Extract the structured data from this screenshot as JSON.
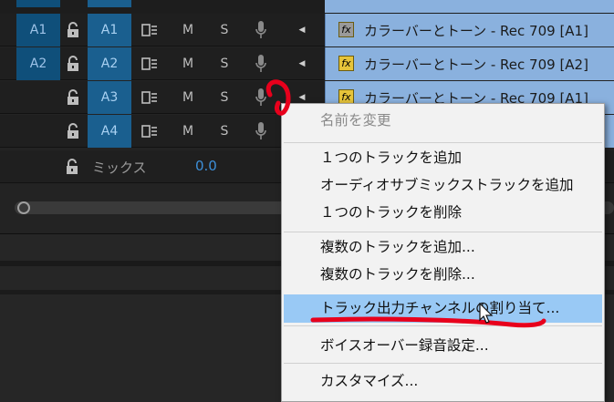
{
  "tracks": [
    {
      "src": "A1",
      "trk": "A1",
      "mute": "M",
      "solo": "S",
      "clip": "カラーバーとトーン - Rec 709 [A1]",
      "fx_color": "#9a9a9a"
    },
    {
      "src": "A2",
      "trk": "A2",
      "mute": "M",
      "solo": "S",
      "clip": "カラーバーとトーン - Rec 709 [A2]",
      "fx_color": "#e6c43a"
    },
    {
      "src": "",
      "trk": "A3",
      "mute": "M",
      "solo": "S",
      "clip": "カラーバーとトーン - Rec 709 [A1]",
      "fx_color": "#e6c43a"
    },
    {
      "src": "",
      "trk": "A4",
      "mute": "M",
      "solo": "S",
      "clip": "",
      "fx_color": ""
    }
  ],
  "mix": {
    "label": "ミックス",
    "value": "0.0"
  },
  "fx_label": "fx",
  "menu": {
    "items": [
      {
        "label": "名前を変更",
        "disabled": true
      },
      {
        "label": "１つのトラックを追加",
        "disabled": false
      },
      {
        "label": "オーディオサブミックストラックを追加",
        "disabled": false
      },
      {
        "label": "１つのトラックを削除",
        "disabled": false
      },
      {
        "label": "複数のトラックを追加...",
        "disabled": false
      },
      {
        "label": "複数のトラックを削除...",
        "disabled": false
      },
      {
        "label": "トラック出力チャンネルの割り当て...",
        "disabled": false
      },
      {
        "label": "ボイスオーバー録音設定...",
        "disabled": false
      },
      {
        "label": "カスタマイズ...",
        "disabled": false
      }
    ]
  },
  "colors": {
    "highlight": "#99c9f5",
    "annotation": "#e8001c",
    "clip": "#8ab1de"
  }
}
